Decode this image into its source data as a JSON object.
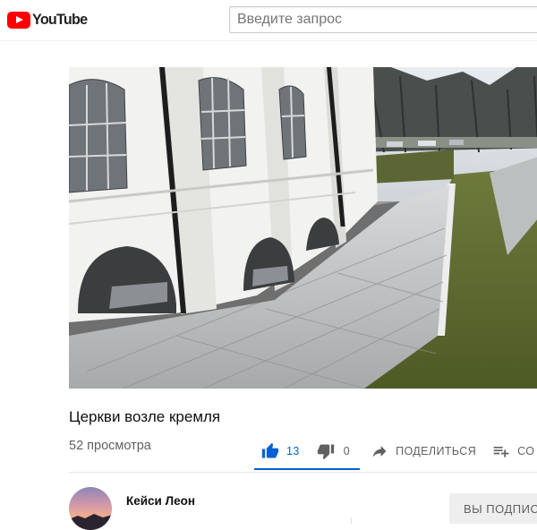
{
  "header": {
    "logo_text": "YouTube",
    "search_placeholder": "Введите запрос"
  },
  "video": {
    "title": "Церкви возле кремля",
    "views": "52 просмотра",
    "actions": {
      "like_count": "13",
      "dislike_count": "0",
      "share_label": "ПОДЕЛИТЬСЯ",
      "save_label": "СО"
    }
  },
  "owner": {
    "channel_name": "Кейси Леон",
    "subscribe_label": "ВЫ ПОДПИСАНЫ"
  },
  "colors": {
    "brand_red": "#ff0000",
    "accent_blue": "#065fd4",
    "secondary_text": "#606060"
  },
  "icons": [
    "youtube-logo-icon",
    "like-icon",
    "dislike-icon",
    "share-icon",
    "add-to-playlist-icon"
  ]
}
